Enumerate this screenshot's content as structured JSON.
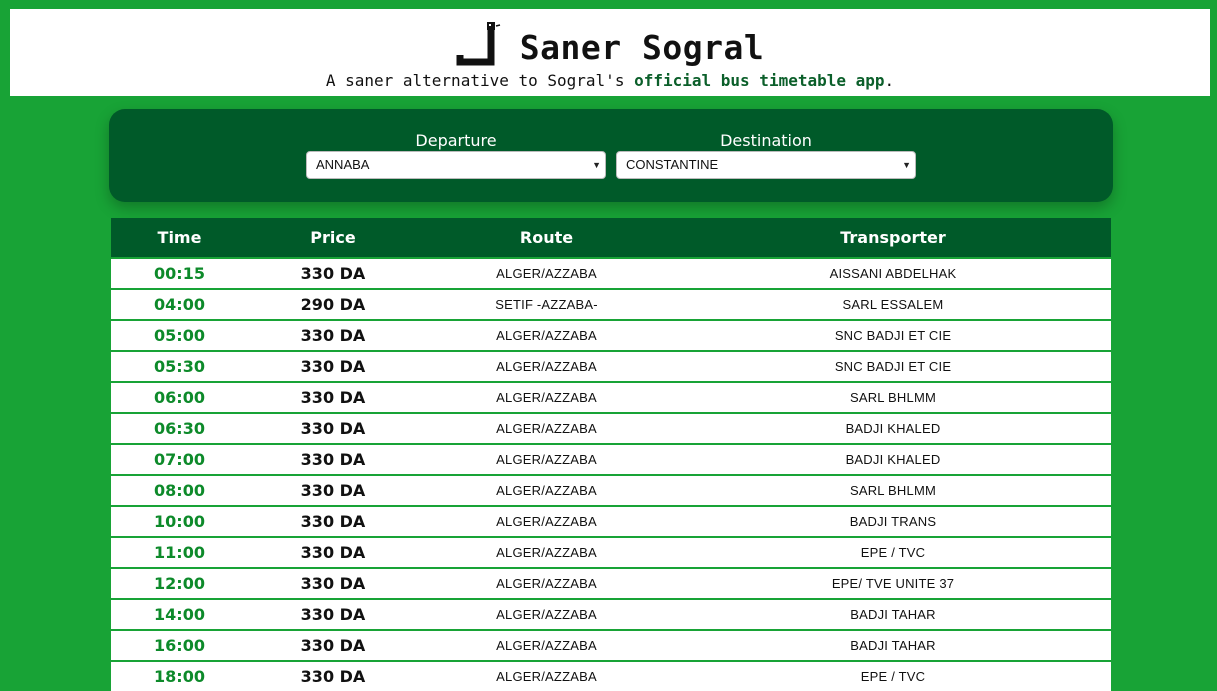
{
  "header": {
    "logo_icon": "snake-icon",
    "title": "Saner Sogral",
    "tagline_prefix": "A saner alternative to Sogral's ",
    "tagline_link": "official bus timetable app",
    "tagline_suffix": "."
  },
  "search": {
    "departure_label": "Departure",
    "departure_value": "ANNABA",
    "destination_label": "Destination",
    "destination_value": "CONSTANTINE"
  },
  "table": {
    "headers": [
      "Time",
      "Price",
      "Route",
      "Transporter"
    ],
    "rows": [
      {
        "time": "00:15",
        "price": "330 DA",
        "route": "ALGER/AZZABA",
        "transporter": "AISSANI ABDELHAK"
      },
      {
        "time": "04:00",
        "price": "290 DA",
        "route": "SETIF -AZZABA-",
        "transporter": "SARL ESSALEM"
      },
      {
        "time": "05:00",
        "price": "330 DA",
        "route": "ALGER/AZZABA",
        "transporter": "SNC BADJI ET CIE"
      },
      {
        "time": "05:30",
        "price": "330 DA",
        "route": "ALGER/AZZABA",
        "transporter": "SNC BADJI ET CIE"
      },
      {
        "time": "06:00",
        "price": "330 DA",
        "route": "ALGER/AZZABA",
        "transporter": "SARL BHLMM"
      },
      {
        "time": "06:30",
        "price": "330 DA",
        "route": "ALGER/AZZABA",
        "transporter": "BADJI KHALED"
      },
      {
        "time": "07:00",
        "price": "330 DA",
        "route": "ALGER/AZZABA",
        "transporter": "BADJI KHALED"
      },
      {
        "time": "08:00",
        "price": "330 DA",
        "route": "ALGER/AZZABA",
        "transporter": "SARL BHLMM"
      },
      {
        "time": "10:00",
        "price": "330 DA",
        "route": "ALGER/AZZABA",
        "transporter": "BADJI TRANS"
      },
      {
        "time": "11:00",
        "price": "330 DA",
        "route": "ALGER/AZZABA",
        "transporter": "EPE / TVC"
      },
      {
        "time": "12:00",
        "price": "330 DA",
        "route": "ALGER/AZZABA",
        "transporter": "EPE/ TVE UNITE 37"
      },
      {
        "time": "14:00",
        "price": "330 DA",
        "route": "ALGER/AZZABA",
        "transporter": "BADJI TAHAR"
      },
      {
        "time": "16:00",
        "price": "330 DA",
        "route": "ALGER/AZZABA",
        "transporter": "BADJI TAHAR"
      },
      {
        "time": "18:00",
        "price": "330 DA",
        "route": "ALGER/AZZABA",
        "transporter": "EPE / TVC"
      }
    ]
  },
  "colors": {
    "background": "#18a336",
    "dark_green": "#005a29",
    "time_green": "#0d8a2a",
    "link_green": "#0b5f2a"
  }
}
